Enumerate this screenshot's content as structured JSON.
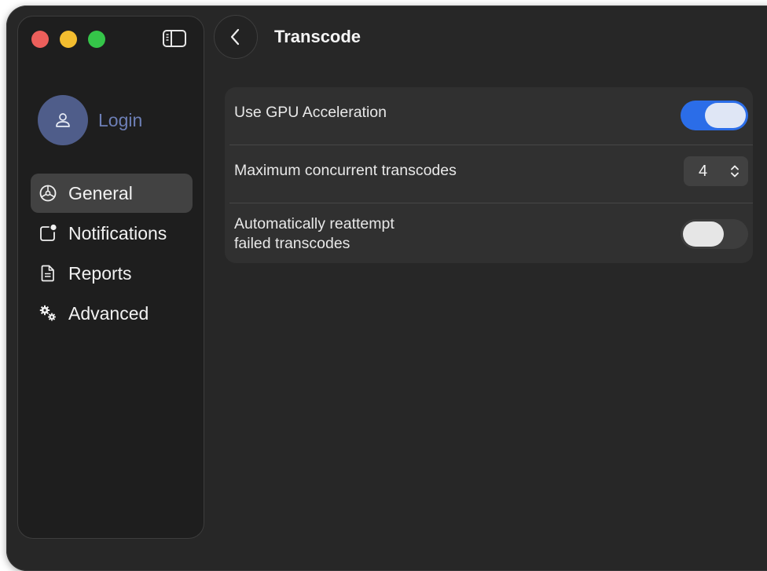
{
  "sidebar": {
    "login_label": "Login",
    "items": [
      {
        "label": "General",
        "icon": "gear-icon",
        "active": true
      },
      {
        "label": "Notifications",
        "icon": "notification-badge-icon",
        "active": false
      },
      {
        "label": "Reports",
        "icon": "document-icon",
        "active": false
      },
      {
        "label": "Advanced",
        "icon": "gears-icon",
        "active": false
      }
    ]
  },
  "header": {
    "title": "Transcode"
  },
  "settings": {
    "gpu_label": "Use GPU Acceleration",
    "gpu_enabled": true,
    "concurrent_label": "Maximum concurrent transcodes",
    "concurrent_value": "4",
    "reattempt_label_line1": "Automatically reattempt",
    "reattempt_label_line2": "failed transcodes",
    "reattempt_enabled": false
  },
  "colors": {
    "accent": "#2b6de8",
    "window_bg": "#272727",
    "sidebar_bg": "#1e1e1e",
    "login_text": "#6d7fb6",
    "avatar_bg": "#4f5d8a"
  }
}
